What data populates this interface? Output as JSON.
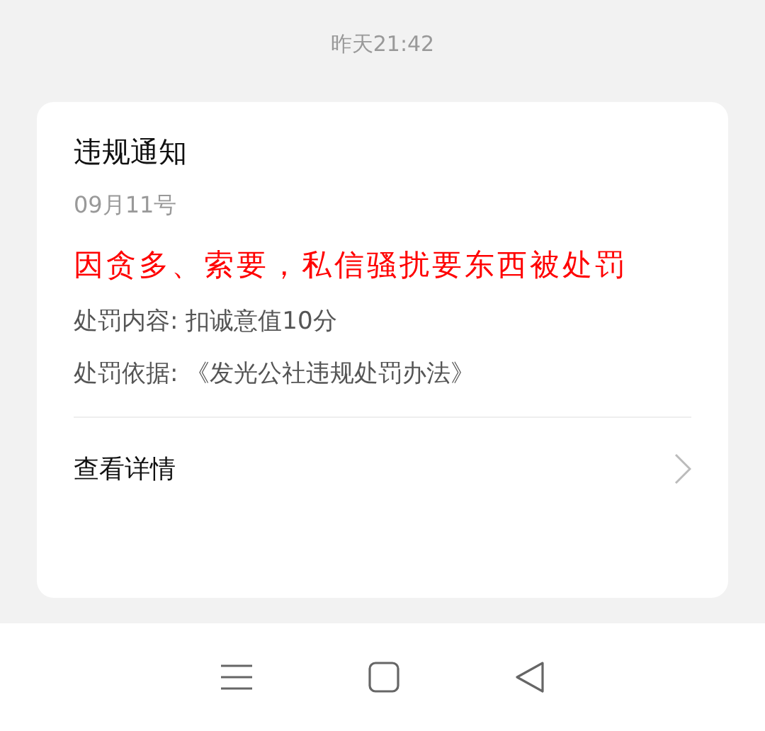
{
  "status_time": "昨天21:42",
  "card": {
    "title": "违规通知",
    "date": "09月11号",
    "headline": "因贪多、索要，私信骚扰要东西被处罚",
    "details": [
      "处罚内容: 扣诚意值10分",
      "处罚依据: 《发光公社违规处罚办法》"
    ],
    "link": "查看详情"
  }
}
